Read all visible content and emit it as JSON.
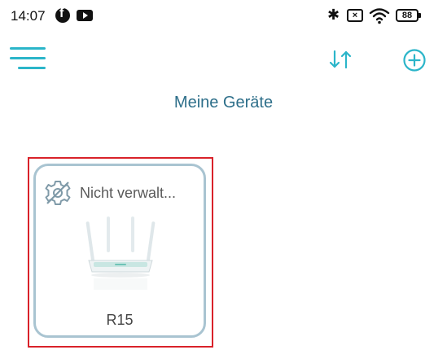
{
  "status_bar": {
    "time": "14:07",
    "battery": "88",
    "sim_symbol": "×",
    "bluetooth_symbol": "✱"
  },
  "toolbar": {
    "menu_icon": "hamburger-menu-icon",
    "sort_icon": "sort-arrows-icon",
    "add_icon": "plus-circle-icon"
  },
  "page": {
    "title": "Meine Geräte"
  },
  "devices": [
    {
      "status": "Nicht verwalt...",
      "status_icon": "unmanaged-gear-icon",
      "name": "R15"
    }
  ],
  "colors": {
    "accent": "#2bb5c9",
    "title": "#2e6f8a",
    "card_border": "#a9c4d1",
    "highlight": "#d9222a"
  }
}
